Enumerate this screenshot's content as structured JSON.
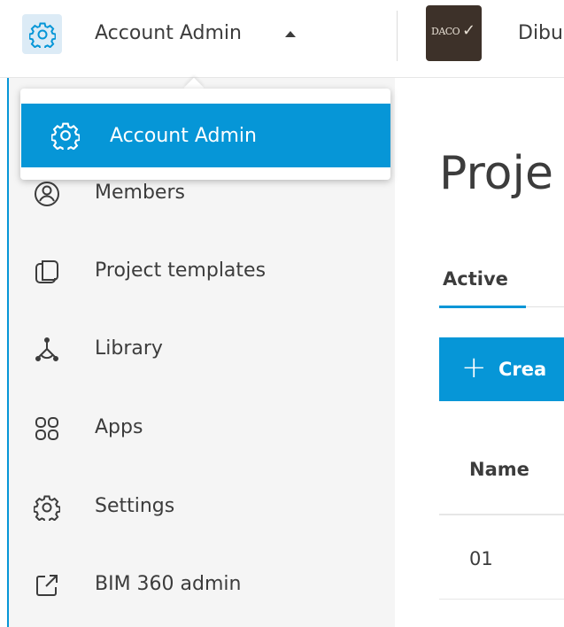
{
  "header": {
    "module_icon": "gear-icon",
    "module_name": "Account Admin",
    "brand_logo_text": "DACO",
    "brand_name": "Dibu"
  },
  "dropdown": {
    "items": [
      {
        "icon": "gear-icon",
        "label": "Account Admin",
        "selected": true
      }
    ]
  },
  "sidebar": {
    "items": [
      {
        "icon": "member-icon",
        "label": "Members"
      },
      {
        "icon": "template-icon",
        "label": "Project templates"
      },
      {
        "icon": "library-icon",
        "label": "Library"
      },
      {
        "icon": "apps-icon",
        "label": "Apps"
      },
      {
        "icon": "gear-icon",
        "label": "Settings"
      },
      {
        "icon": "external-link-icon",
        "label": "BIM 360 admin"
      }
    ]
  },
  "main": {
    "title": "Proje",
    "tabs": [
      {
        "label": "Active",
        "active": true
      }
    ],
    "create_button": {
      "label": "Crea"
    },
    "table": {
      "columns": [
        "Name"
      ],
      "rows": [
        [
          "01"
        ]
      ]
    }
  },
  "colors": {
    "accent": "#0696d7",
    "module_button_bg": "#dcebf6",
    "sidebar_bg": "#f5f5f5",
    "text": "#3c3c3c"
  }
}
